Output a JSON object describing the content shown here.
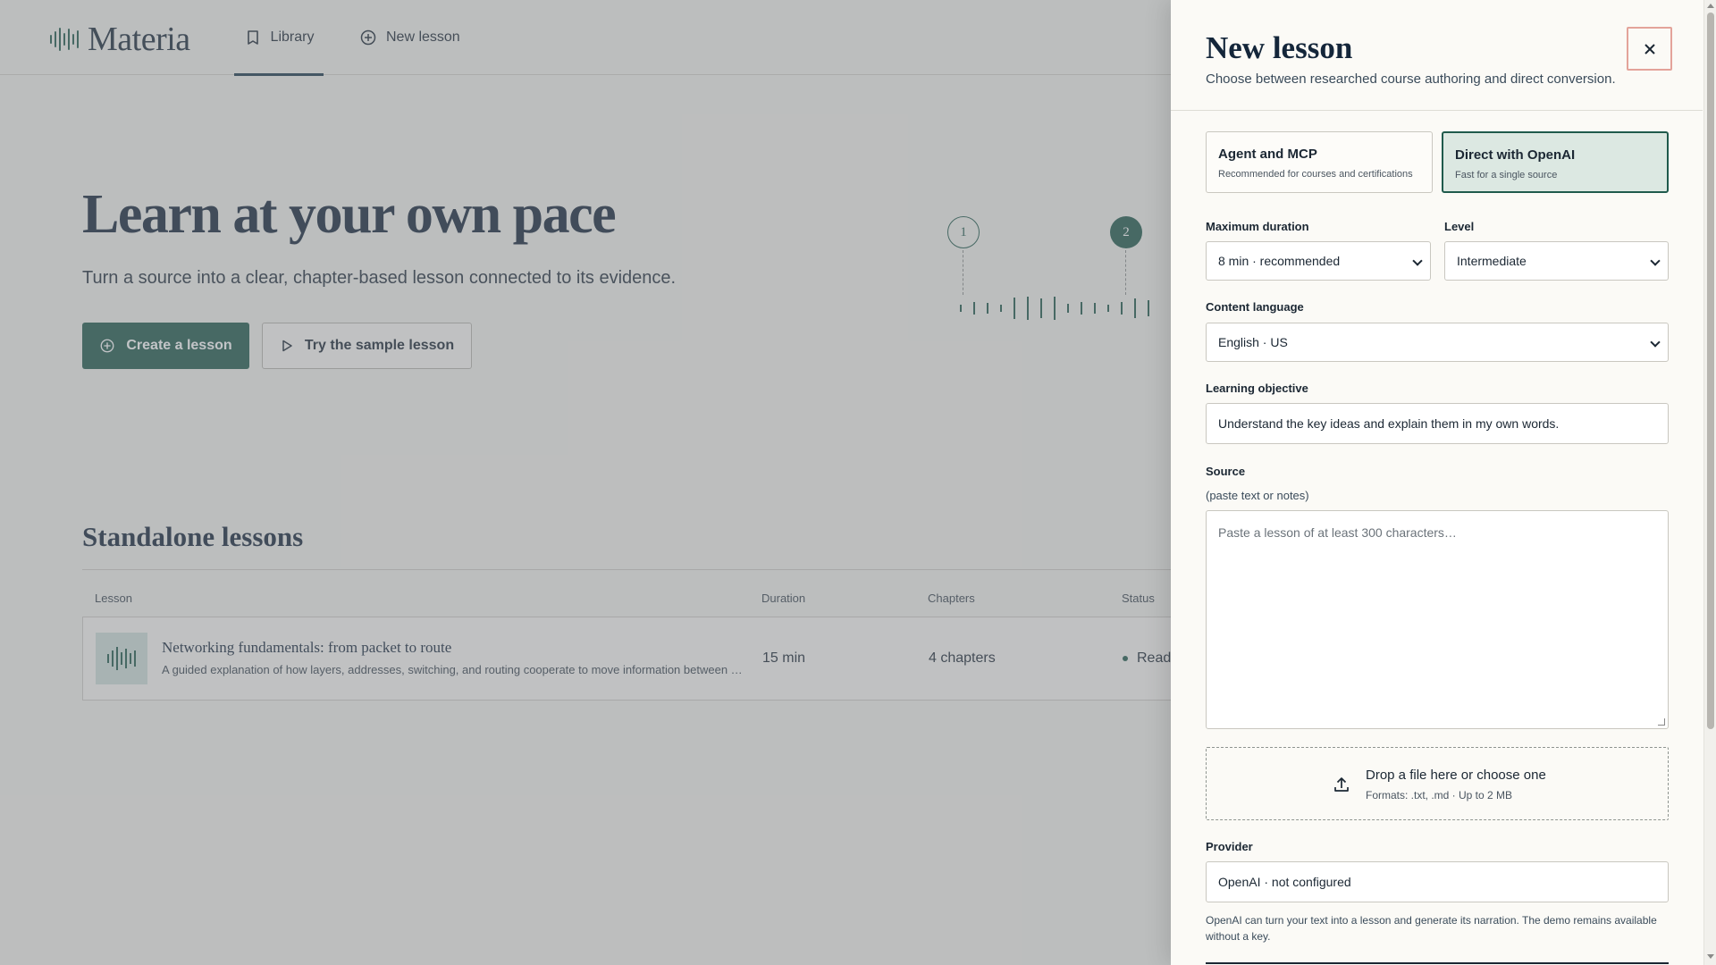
{
  "brand": {
    "name": "Materia"
  },
  "nav": {
    "library": "Library",
    "new_lesson": "New lesson"
  },
  "hero": {
    "title": "Learn at your own pace",
    "subtitle": "Turn a source into a clear, chapter-based lesson connected to its evidence.",
    "primary_button": "Create a lesson",
    "secondary_button": "Try the sample lesson"
  },
  "timeline": {
    "step1": "1",
    "step2": "2",
    "active_step": 2
  },
  "standalone": {
    "title": "Standalone lessons",
    "columns": [
      "Lesson",
      "Duration",
      "Chapters",
      "Status"
    ],
    "rows": [
      {
        "title": "Networking fundamentals: from packet to route",
        "description": "A guided explanation of how layers, addresses, switching, and routing cooperate to move information between networks.",
        "duration": "15 min",
        "chapters": "4 chapters",
        "status": "Ready"
      }
    ]
  },
  "panel": {
    "title": "New lesson",
    "subtitle": "Choose between researched course authoring and direct conversion.",
    "modes": [
      {
        "title": "Agent and MCP",
        "subtitle": "Recommended for courses and certifications",
        "selected": false
      },
      {
        "title": "Direct with OpenAI",
        "subtitle": "Fast for a single source",
        "selected": true
      }
    ],
    "max_duration": {
      "label": "Maximum duration",
      "value": "8 min · recommended"
    },
    "level": {
      "label": "Level",
      "value": "Intermediate"
    },
    "content_language": {
      "label": "Content language",
      "value": "English · US"
    },
    "learning_objective": {
      "label": "Learning objective",
      "value": "Understand the key ideas and explain them in my own words."
    },
    "source": {
      "label": "Source",
      "hint": "(paste text or notes)",
      "placeholder": "Paste a lesson of at least 300 characters…"
    },
    "dropzone": {
      "title": "Drop a file here or choose one",
      "subtitle": "Formats: .txt, .md · Up to 2 MB"
    },
    "provider": {
      "label": "Provider",
      "value": "OpenAI · not configured",
      "note": "OpenAI can turn your text into a lesson and generate its narration. The demo remains available without a key."
    }
  },
  "colors": {
    "accent": "#1f5a4c",
    "background": "#f5f4ef",
    "selected_card": "#dce8e2",
    "close_outline": "#e3a39a"
  },
  "icons": [
    "waveform-logo-icon",
    "book-icon",
    "plus-circle-icon",
    "play-icon",
    "close-icon",
    "upload-icon",
    "chevron-down-icon"
  ]
}
